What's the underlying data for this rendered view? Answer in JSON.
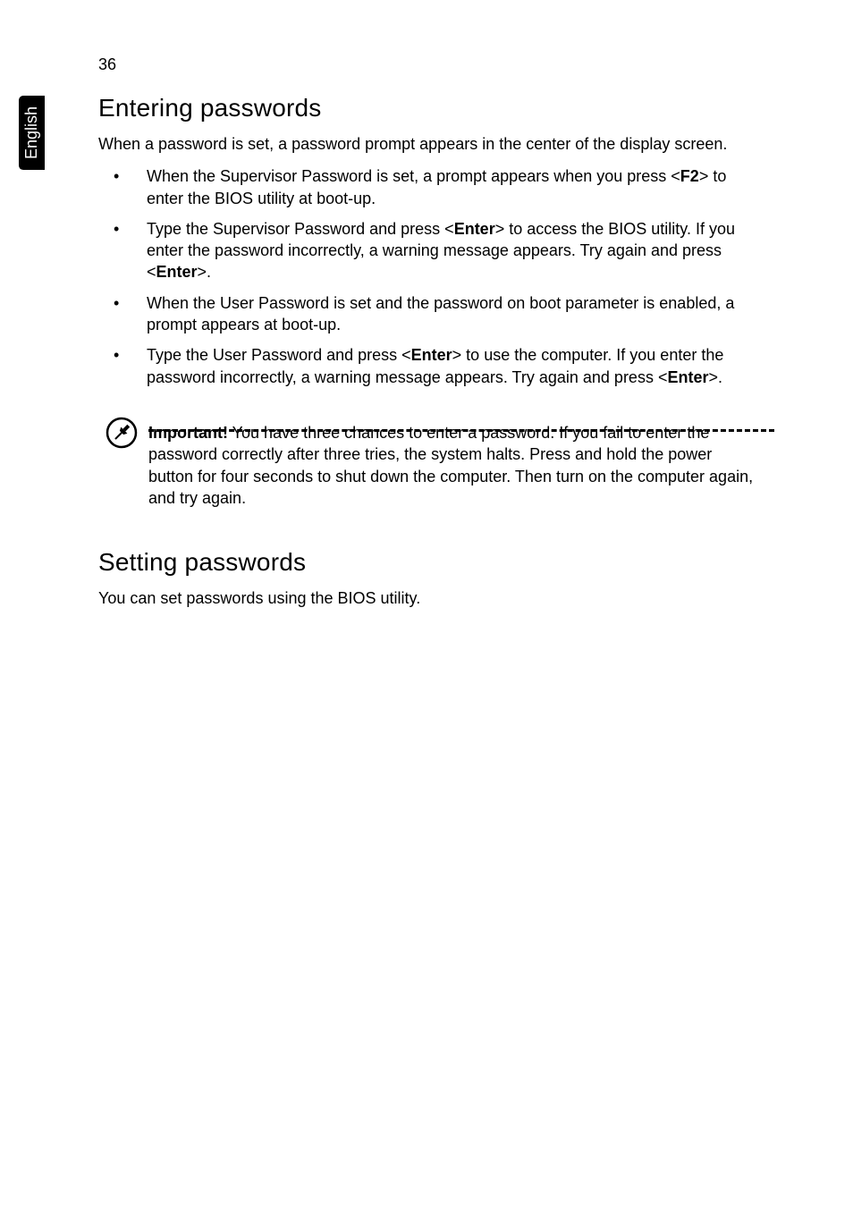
{
  "page_number": "36",
  "sidebar_label": "English",
  "section1": {
    "heading": "Entering passwords",
    "intro": "When a password is set, a password prompt appears in the center of the display screen.",
    "bullets": [
      {
        "pre": "When the Supervisor Password is set, a prompt appears when you press <",
        "key": "F2",
        "post": "> to enter the BIOS utility at boot-up."
      },
      {
        "pre": "Type the Supervisor Password and press <",
        "key": "Enter",
        "mid": "> to access the BIOS utility. If you enter the password incorrectly, a warning message appears. Try again and press <",
        "key2": "Enter",
        "post": ">."
      },
      {
        "pre": "When the User Password is set and the password on boot parameter is enabled, a prompt appears at boot-up.",
        "key": "",
        "post": ""
      },
      {
        "pre": "Type the User Password and press <",
        "key": "Enter",
        "mid": "> to use the computer. If you enter the password incorrectly, a warning message appears. Try again and press <",
        "key2": "Enter",
        "post": ">."
      }
    ],
    "note": {
      "label": "Important!",
      "text": " You have three chances to enter a password. If you fail to enter the password correctly after three tries, the system halts. Press and hold the power button for four seconds to shut down the computer. Then turn on the computer again, and try again."
    }
  },
  "section2": {
    "heading": "Setting passwords",
    "intro": "You can set passwords using the BIOS utility."
  }
}
